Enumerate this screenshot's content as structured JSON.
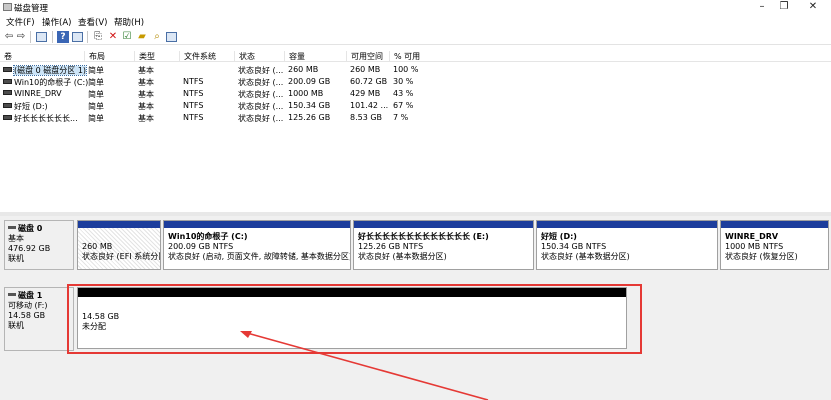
{
  "window": {
    "title": "磁盘管理",
    "controls": {
      "minimize": "–",
      "maximize": "❐",
      "close": "✕"
    }
  },
  "menu": [
    "文件(F)",
    "操作(A)",
    "查看(V)",
    "帮助(H)"
  ],
  "volume_list": {
    "headers": [
      "卷",
      "布局",
      "类型",
      "文件系统",
      "状态",
      "容量",
      "可用空间",
      "% 可用"
    ],
    "rows": [
      {
        "name": "(磁盘 0 磁盘分区 1)",
        "layout": "简单",
        "type": "基本",
        "fs": "",
        "status": "状态良好 (...",
        "capacity": "260 MB",
        "free": "260 MB",
        "pct": "100 %",
        "selected": true
      },
      {
        "name": "Win10的命根子 (C:)",
        "layout": "简单",
        "type": "基本",
        "fs": "NTFS",
        "status": "状态良好 (...",
        "capacity": "200.09 GB",
        "free": "60.72 GB",
        "pct": "30 %"
      },
      {
        "name": "WINRE_DRV",
        "layout": "简单",
        "type": "基本",
        "fs": "NTFS",
        "status": "状态良好 (...",
        "capacity": "1000 MB",
        "free": "429 MB",
        "pct": "43 %"
      },
      {
        "name": "好短 (D:)",
        "layout": "简单",
        "type": "基本",
        "fs": "NTFS",
        "status": "状态良好 (...",
        "capacity": "150.34 GB",
        "free": "101.42 ...",
        "pct": "67 %"
      },
      {
        "name": "好长长长长长长...",
        "layout": "简单",
        "type": "基本",
        "fs": "NTFS",
        "status": "状态良好 (...",
        "capacity": "125.26 GB",
        "free": "8.53 GB",
        "pct": "7 %"
      }
    ]
  },
  "disks": [
    {
      "name": "磁盘 0",
      "kind": "基本",
      "size": "476.92 GB",
      "state": "联机",
      "partitions": [
        {
          "title": "",
          "size": "260 MB",
          "status": "状态良好 (EFI 系统分区)"
        },
        {
          "title": "Win10的命根子 (C:)",
          "size": "200.09 GB NTFS",
          "status": "状态良好 (启动, 页面文件, 故障转储, 基本数据分区)"
        },
        {
          "title": "好长长长长长长长长长长长长长 (E:)",
          "size": "125.26 GB NTFS",
          "status": "状态良好 (基本数据分区)"
        },
        {
          "title": "好短 (D:)",
          "size": "150.34 GB NTFS",
          "status": "状态良好 (基本数据分区)"
        },
        {
          "title": "WINRE_DRV",
          "size": "1000 MB NTFS",
          "status": "状态良好 (恢复分区)"
        }
      ]
    },
    {
      "name": "磁盘 1",
      "kind": "可移动 (F:)",
      "size": "14.58 GB",
      "state": "联机",
      "partitions": [
        {
          "size": "14.58 GB",
          "status": "未分配"
        }
      ]
    }
  ],
  "colors": {
    "primary_partition_bar": "#1c3d9c",
    "unallocated_bar": "#000000",
    "highlight": "#e53935"
  }
}
